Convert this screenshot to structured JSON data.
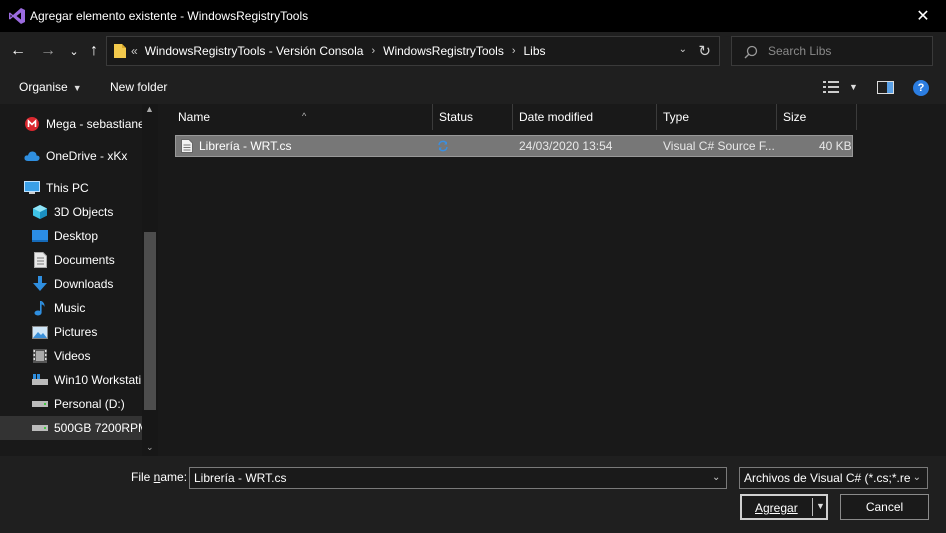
{
  "window": {
    "title": "Agregar elemento existente - WindowsRegistryTools",
    "close_glyph": "✕"
  },
  "nav": {
    "back_glyph": "←",
    "forward_glyph": "→",
    "recent_glyph": "⌄",
    "up_glyph": "↑"
  },
  "address": {
    "lead": "«",
    "crumbs": [
      "WindowsRegistryTools - Versión Consola",
      "WindowsRegistryTools",
      "Libs"
    ],
    "separator": "›",
    "dropdown_glyph": "⌄",
    "refresh_glyph": "↻"
  },
  "search": {
    "placeholder": "Search Libs"
  },
  "toolbar": {
    "organise_label": "Organise",
    "new_folder_label": "New folder",
    "help_label": "?"
  },
  "sidebar": {
    "items": [
      {
        "label": "Mega - sebastiane",
        "icon": "mega-icon"
      },
      {
        "label": "OneDrive - xKx",
        "icon": "cloud-icon"
      },
      {
        "label": "This PC",
        "icon": "computer-icon"
      },
      {
        "label": "3D Objects",
        "icon": "cube-icon"
      },
      {
        "label": "Desktop",
        "icon": "desktop-icon"
      },
      {
        "label": "Documents",
        "icon": "document-icon"
      },
      {
        "label": "Downloads",
        "icon": "download-icon"
      },
      {
        "label": "Music",
        "icon": "music-icon"
      },
      {
        "label": "Pictures",
        "icon": "pictures-icon"
      },
      {
        "label": "Videos",
        "icon": "video-icon"
      },
      {
        "label": "Win10 Workstati",
        "icon": "drive-windows-icon"
      },
      {
        "label": "Personal (D:)",
        "icon": "drive-icon"
      },
      {
        "label": "500GB 7200RPM",
        "icon": "drive-icon"
      }
    ]
  },
  "columns": {
    "name": "Name",
    "status": "Status",
    "date_modified": "Date modified",
    "type": "Type",
    "size": "Size"
  },
  "files": [
    {
      "name": "Librería - WRT.cs",
      "status_icon": "sync-icon",
      "date_modified": "24/03/2020 13:54",
      "type": "Visual C# Source F...",
      "size": "40 KB"
    }
  ],
  "footer": {
    "file_name_prefix": "File ",
    "file_name_underlined": "n",
    "file_name_suffix": "ame:",
    "file_name_value": "Librería - WRT.cs",
    "filter_value": "Archivos de Visual C# (*.cs;*.resx",
    "open_label": "Agregar",
    "cancel_label": "Cancel"
  },
  "colors": {
    "background": "#191919",
    "selected_row": "#777777",
    "accent": "#2b7de1"
  }
}
